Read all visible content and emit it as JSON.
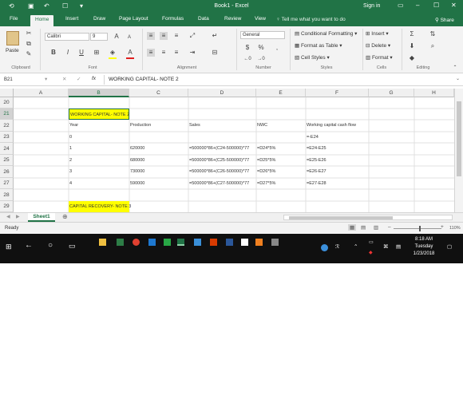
{
  "titlebar": {
    "title": "Book1 - Excel",
    "signin": "Sign in"
  },
  "tabs": [
    "File",
    "Home",
    "Insert",
    "Draw",
    "Page Layout",
    "Formulas",
    "Data",
    "Review",
    "View"
  ],
  "tell_me": "Tell me what you want to do",
  "share": "Share",
  "ribbon": {
    "paste": "Paste",
    "font_name": "Calibri",
    "font_size": "9",
    "number_format": "General",
    "conditional_formatting": "Conditional Formatting",
    "format_as_table": "Format as Table",
    "cell_styles": "Cell Styles",
    "insert": "Insert",
    "delete": "Delete",
    "format": "Format",
    "group_labels": [
      "Clipboard",
      "Font",
      "Alignment",
      "Number",
      "Styles",
      "Cells",
      "Editing"
    ],
    "accent": "#217346"
  },
  "formula_bar": {
    "name_box": "B21",
    "fx": "fx",
    "content": "WORKING CAPITAL- NOTE 2"
  },
  "columns": [
    "A",
    "B",
    "C",
    "D",
    "E",
    "F",
    "G",
    "H"
  ],
  "rows": [
    {
      "num": "20",
      "cells": [
        "",
        "",
        "",
        "",
        "",
        ""
      ]
    },
    {
      "num": "21",
      "cells": [
        "WORKING CAPITAL- NOTE 2",
        "",
        "",
        "",
        "",
        ""
      ]
    },
    {
      "num": "22",
      "cells": [
        "Year",
        "Production",
        "Sales",
        "NWC",
        "Working capital cash flow",
        ""
      ]
    },
    {
      "num": "23",
      "cells": [
        "0",
        "",
        "",
        "",
        "=-E24",
        ""
      ]
    },
    {
      "num": "24",
      "cells": [
        "1",
        "620000",
        "=500000*86+(C24-500000)*77",
        "=D24*5%",
        "=E24-E25",
        ""
      ]
    },
    {
      "num": "25",
      "cells": [
        "2",
        "680000",
        "=500000*86+(C25-500000)*77",
        "=D25*5%",
        "=E25-E26",
        ""
      ]
    },
    {
      "num": "26",
      "cells": [
        "3",
        "730000",
        "=500000*86+(C26-500000)*77",
        "=D26*5%",
        "=E26-E27",
        ""
      ]
    },
    {
      "num": "27",
      "cells": [
        "4",
        "590000",
        "=500000*86+(C27-500000)*77",
        "=D27*5%",
        "=E27-E28",
        ""
      ]
    },
    {
      "num": "28",
      "cells": [
        "",
        "",
        "",
        "",
        "",
        ""
      ]
    },
    {
      "num": "29",
      "cells": [
        "CAPITAL RECOVERY- NOTE 3",
        "",
        "",
        "",
        "",
        ""
      ]
    }
  ],
  "highlight_color": "#ffff00",
  "sheet_tab": "Sheet1",
  "status": {
    "ready": "Ready",
    "zoom": "110%"
  },
  "taskbar": {
    "time": "8:18 AM",
    "day": "Tuesday",
    "date": "1/23/2018"
  }
}
